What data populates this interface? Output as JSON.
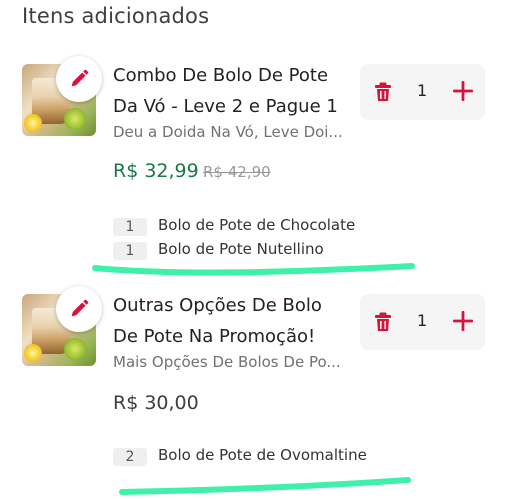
{
  "section_title": "Itens adicionados",
  "items": [
    {
      "name_line1": "Combo De Bolo De Pote",
      "name_line2": "Da Vó - Leve 2 e Pague 1",
      "description": "Deu a Doida Na Vó, Leve Doi...",
      "price": "R$ 32,99",
      "old_price": "R$ 42,90",
      "quantity": "1",
      "subitems": [
        {
          "qty": "1",
          "name": "Bolo de Pote de Chocolate"
        },
        {
          "qty": "1",
          "name": "Bolo de Pote Nutellino"
        }
      ]
    },
    {
      "name_line1": "Outras Opções De Bolo",
      "name_line2": "De Pote Na Promoção!",
      "description": "Mais Opções De Bolos De Po...",
      "price": "R$ 30,00",
      "quantity": "1",
      "subitems": [
        {
          "qty": "2",
          "name": "Bolo de Pote de Ovomaltine"
        }
      ]
    }
  ],
  "colors": {
    "brand_red": "#d6133c",
    "sale_green": "#1a7a45",
    "highlight_stroke": "#3ff0a8"
  },
  "icons": {
    "edit": "pencil-icon",
    "remove": "trash-icon",
    "add": "plus-icon"
  }
}
